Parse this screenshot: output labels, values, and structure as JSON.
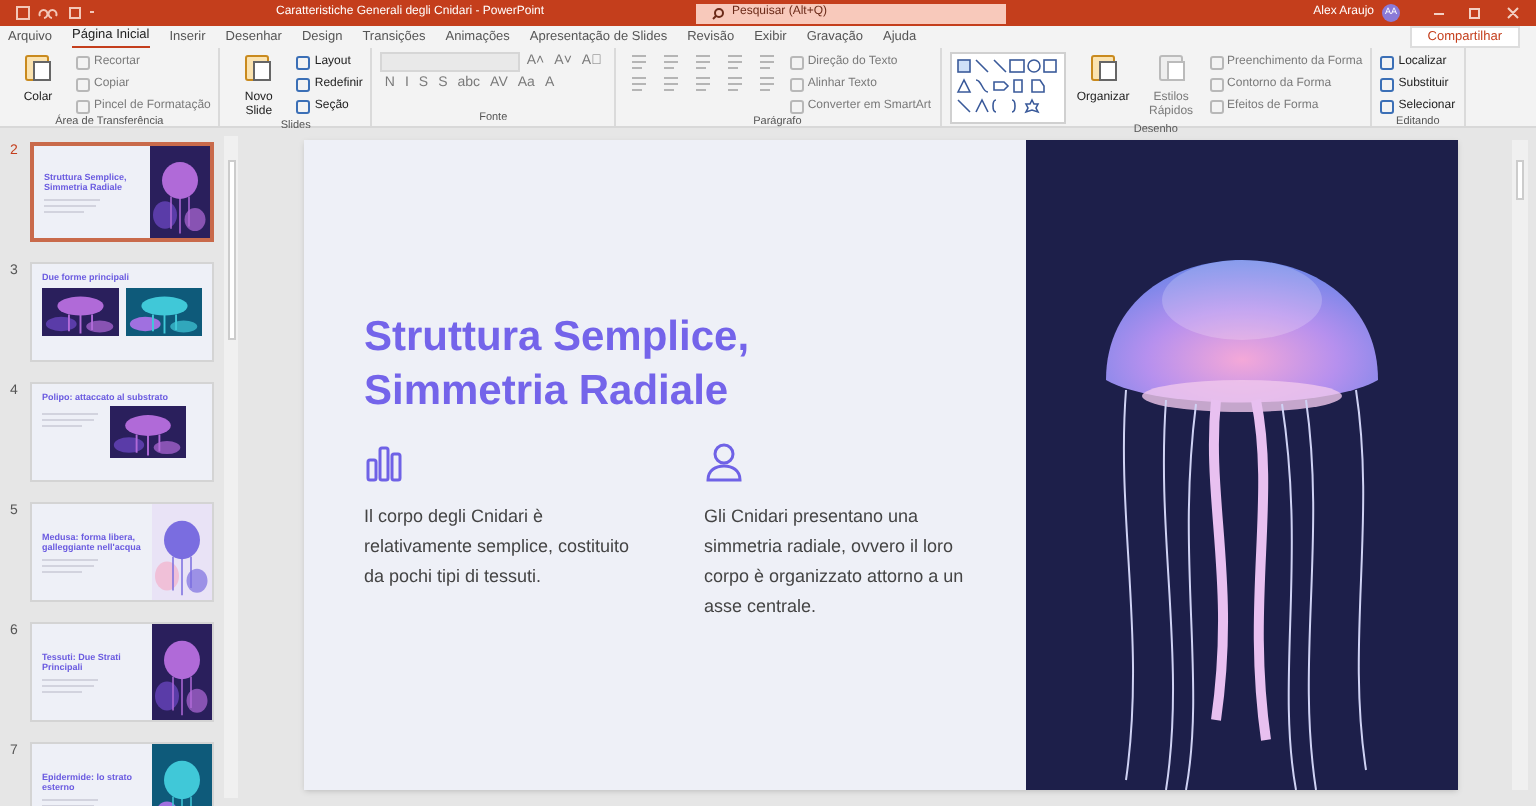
{
  "title_bar": {
    "title": "Caratteristiche Generali degli Cnidari  -  PowerPoint",
    "search_placeholder": "Pesquisar (Alt+Q)",
    "user_name": "Alex Araujo",
    "avatar": "AA"
  },
  "tabs": [
    {
      "label": "Arquivo",
      "selected": false
    },
    {
      "label": "Página Inicial",
      "selected": true
    },
    {
      "label": "Inserir",
      "selected": false
    },
    {
      "label": "Desenhar",
      "selected": false
    },
    {
      "label": "Design",
      "selected": false
    },
    {
      "label": "Transições",
      "selected": false
    },
    {
      "label": "Animações",
      "selected": false
    },
    {
      "label": "Apresentação de Slides",
      "selected": false
    },
    {
      "label": "Revisão",
      "selected": false
    },
    {
      "label": "Exibir",
      "selected": false
    },
    {
      "label": "Gravação",
      "selected": false
    },
    {
      "label": "Ajuda",
      "selected": false
    }
  ],
  "share_button": "Compartilhar",
  "ribbon": [
    {
      "label": "Área de Transferência",
      "columns": [
        [
          [
            {
              "kind": "large",
              "label": "Colar",
              "disabled": false
            }
          ]
        ],
        [
          [
            {
              "kind": "small",
              "label": "Recortar",
              "disabled": true
            }
          ],
          [
            {
              "kind": "small",
              "label": "Copiar",
              "disabled": true
            }
          ],
          [
            {
              "kind": "small",
              "label": "Pincel de Formatação",
              "disabled": true
            }
          ]
        ]
      ]
    },
    {
      "label": "Slides",
      "columns": [
        [
          [
            {
              "kind": "large",
              "label": "Novo Slide",
              "disabled": false
            }
          ]
        ],
        [
          [
            {
              "kind": "small",
              "label": "Layout",
              "disabled": false
            }
          ],
          [
            {
              "kind": "small",
              "label": "Redefinir",
              "disabled": false
            }
          ],
          [
            {
              "kind": "small",
              "label": "Seção",
              "disabled": false
            }
          ]
        ]
      ]
    },
    {
      "label": "Fonte",
      "columns": [
        [
          [
            {
              "kind": "field",
              "disabled": true
            },
            {
              "kind": "glyph",
              "label": "A˄",
              "disabled": true
            },
            {
              "kind": "glyph",
              "label": "A˅",
              "disabled": true
            },
            {
              "kind": "glyph",
              "label": "A⃠",
              "disabled": true
            }
          ],
          [
            {
              "kind": "glyph",
              "label": "N",
              "disabled": true
            },
            {
              "kind": "glyph",
              "label": "I",
              "disabled": true
            },
            {
              "kind": "glyph",
              "label": "S",
              "disabled": true
            },
            {
              "kind": "glyph",
              "label": "S",
              "disabled": true
            },
            {
              "kind": "glyph",
              "label": "abc",
              "disabled": true
            },
            {
              "kind": "glyph",
              "label": "AV",
              "disabled": true
            },
            {
              "kind": "glyph",
              "label": "Aa",
              "disabled": true
            },
            {
              "kind": "glyph",
              "label": "A",
              "disabled": true
            }
          ]
        ]
      ]
    },
    {
      "label": "Parágrafo",
      "columns": [
        [
          [
            {
              "kind": "icon",
              "disabled": true
            },
            {
              "kind": "icon",
              "disabled": true
            },
            {
              "kind": "icon",
              "disabled": true
            },
            {
              "kind": "icon",
              "disabled": true
            },
            {
              "kind": "icon",
              "disabled": true
            }
          ],
          [
            {
              "kind": "icon",
              "disabled": true
            },
            {
              "kind": "icon",
              "disabled": true
            },
            {
              "kind": "icon",
              "disabled": true
            },
            {
              "kind": "icon",
              "disabled": true
            },
            {
              "kind": "icon",
              "disabled": true
            }
          ]
        ],
        [
          [
            {
              "kind": "small",
              "label": "Direção do Texto",
              "disabled": true
            }
          ],
          [
            {
              "kind": "small",
              "label": "Alinhar Texto",
              "disabled": true
            }
          ],
          [
            {
              "kind": "small",
              "label": "Converter em SmartArt",
              "disabled": true
            }
          ]
        ]
      ]
    },
    {
      "label": "Desenho",
      "columns": [
        [
          [
            {
              "kind": "shapes",
              "disabled": false
            }
          ]
        ],
        [
          [
            {
              "kind": "large",
              "label": "Organizar",
              "disabled": false
            }
          ]
        ],
        [
          [
            {
              "kind": "large",
              "label": "Estilos Rápidos",
              "disabled": true
            }
          ]
        ],
        [
          [
            {
              "kind": "small",
              "label": "Preenchimento da Forma",
              "disabled": true
            }
          ],
          [
            {
              "kind": "small",
              "label": "Contorno da Forma",
              "disabled": true
            }
          ],
          [
            {
              "kind": "small",
              "label": "Efeitos de Forma",
              "disabled": true
            }
          ]
        ]
      ]
    },
    {
      "label": "Editando",
      "columns": [
        [
          [
            {
              "kind": "small",
              "label": "Localizar",
              "disabled": false
            }
          ],
          [
            {
              "kind": "small",
              "label": "Substituir",
              "disabled": false
            }
          ],
          [
            {
              "kind": "small",
              "label": "Selecionar",
              "disabled": false
            }
          ]
        ]
      ]
    }
  ],
  "thumbnails": [
    {
      "number": "2",
      "title": "Struttura Semplice, Simmetria Radiale",
      "kind": "split",
      "selected": true
    },
    {
      "number": "3",
      "title": "Due forme principali",
      "kind": "two_pictures",
      "selected": false
    },
    {
      "number": "4",
      "title": "Polipo: attaccato al substrato",
      "kind": "small_picture",
      "selected": false
    },
    {
      "number": "5",
      "title": "Medusa: forma libera, galleggiante nell'acqua",
      "kind": "split",
      "selected": false
    },
    {
      "number": "6",
      "title": "Tessuti: Due Strati Principali",
      "kind": "split",
      "selected": false
    },
    {
      "number": "7",
      "title": "Epidermide: lo strato esterno",
      "kind": "split",
      "selected": false
    }
  ],
  "slide": {
    "title": "Struttura Semplice, Simmetria Radiale",
    "columns": [
      {
        "kind": "chart",
        "text": "Il corpo degli Cnidari è relativamente semplice, costituito da pochi tipi di tessuti."
      },
      {
        "kind": "person",
        "text": "Gli Cnidari presentano una simmetria radiale, ovvero il loro corpo è organizzato attorno a un asse centrale."
      }
    ]
  }
}
